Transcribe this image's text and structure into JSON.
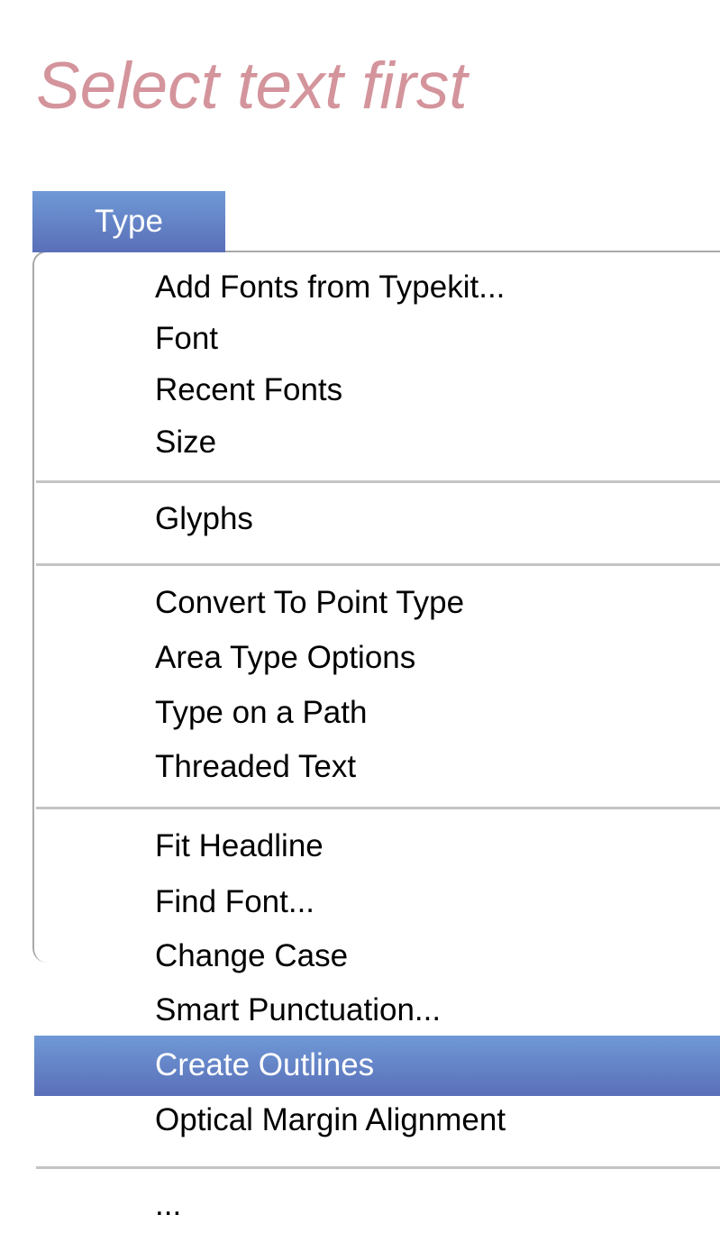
{
  "instruction": "Select text first",
  "menu": {
    "title": "Type",
    "items": [
      {
        "label": "Add Fonts from Typekit..."
      },
      {
        "label": "Font"
      },
      {
        "label": "Recent Fonts"
      },
      {
        "label": "Size"
      },
      {
        "label": "Glyphs"
      },
      {
        "label": "Convert To Point Type"
      },
      {
        "label": "Area Type Options"
      },
      {
        "label": "Type on a Path"
      },
      {
        "label": "Threaded Text"
      },
      {
        "label": "Fit Headline"
      },
      {
        "label": "Find Font..."
      },
      {
        "label": "Change Case"
      },
      {
        "label": "Smart Punctuation..."
      },
      {
        "label": "Create Outlines",
        "highlighted": true
      },
      {
        "label": "Optical Margin Alignment"
      },
      {
        "label": "..."
      }
    ]
  },
  "colors": {
    "instruction_text": "#d4949c",
    "highlight_top": "#6f99d6",
    "highlight_bottom": "#5a6fb8",
    "separator": "#c4c4c4"
  }
}
